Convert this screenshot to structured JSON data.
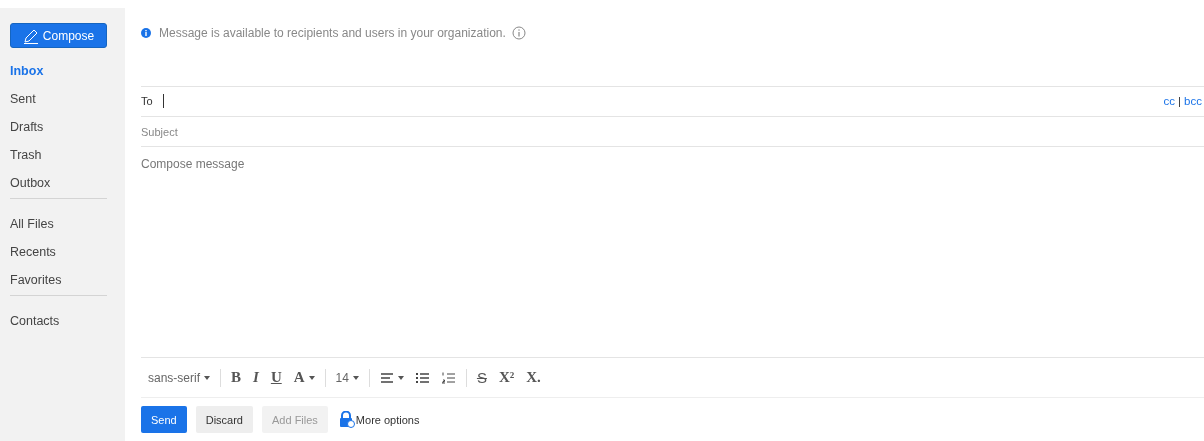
{
  "sidebar": {
    "compose_button": "Compose",
    "groups": [
      [
        {
          "label": "Inbox",
          "selected": true
        },
        {
          "label": "Sent",
          "selected": false
        },
        {
          "label": "Drafts",
          "selected": false
        },
        {
          "label": "Trash",
          "selected": false
        },
        {
          "label": "Outbox",
          "selected": false
        }
      ],
      [
        {
          "label": "All Files",
          "selected": false
        },
        {
          "label": "Recents",
          "selected": false
        },
        {
          "label": "Favorites",
          "selected": false
        }
      ],
      [
        {
          "label": "Contacts",
          "selected": false
        }
      ]
    ]
  },
  "notice": "Message is available to recipients and users in your organization.",
  "to": {
    "label": "To",
    "cc": "cc",
    "separator": "|",
    "bcc": "bcc"
  },
  "subject": {
    "placeholder": "Subject"
  },
  "body": {
    "placeholder": "Compose message"
  },
  "toolbar": [
    [
      {
        "kind": "select",
        "label": "sans-serif"
      }
    ],
    [
      {
        "kind": "bold",
        "label": "B"
      },
      {
        "kind": "italic",
        "label": "I"
      },
      {
        "kind": "underline",
        "label": "U"
      },
      {
        "kind": "color",
        "label": "A"
      }
    ],
    [
      {
        "kind": "select",
        "label": "14"
      }
    ],
    [
      {
        "kind": "align"
      },
      {
        "kind": "bullets"
      },
      {
        "kind": "numbers"
      }
    ],
    [
      {
        "kind": "strike",
        "label": "S"
      },
      {
        "kind": "superscript",
        "label": "X²"
      },
      {
        "kind": "subscript",
        "label": "X."
      }
    ]
  ],
  "actions": [
    {
      "label": "Send",
      "kind": "primary"
    },
    {
      "label": "Discard",
      "kind": "secondary"
    },
    {
      "label": "Add Files",
      "kind": "disabled"
    },
    {
      "label": "More options",
      "kind": "link"
    }
  ]
}
